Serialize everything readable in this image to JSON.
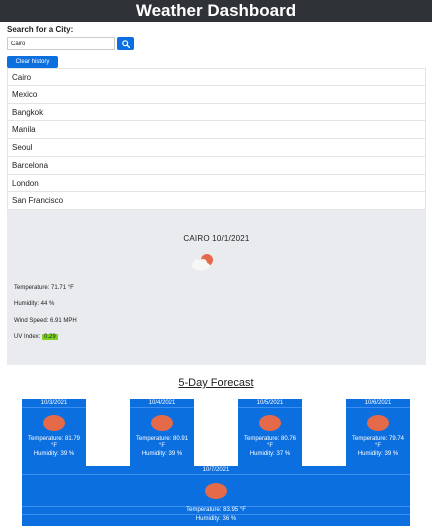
{
  "header": {
    "title": "Weather Dashboard"
  },
  "search": {
    "label": "Search for a City:",
    "value": "Cairo"
  },
  "clear_history_label": "Clear history",
  "history": [
    "Cairo",
    "Mexico",
    "Bangkok",
    "Manila",
    "Seoul",
    "Barcelona",
    "London",
    "San Francisco"
  ],
  "current": {
    "title": "CAIRO 10/1/2021",
    "icon": "partly-cloudy-icon",
    "temperature": "Temperature: 71.71 °F",
    "humidity": "Humidity: 44 %",
    "wind": "Wind Speed: 6.91 MPH",
    "uv_label": "UV Index:",
    "uv_value": "0.29"
  },
  "forecast": {
    "title": "5-Day Forecast",
    "days": [
      {
        "date": "10/3/2021",
        "temperature": "Temperature: 81.79",
        "unit": "°F",
        "humidity": "Humidity: 39 %"
      },
      {
        "date": "10/4/2021",
        "temperature": "Temperature: 80.91",
        "unit": "°F",
        "humidity": "Humidity: 39 %"
      },
      {
        "date": "10/5/2021",
        "temperature": "Temperature: 80.76",
        "unit": "°F",
        "humidity": "Humidity: 37 %"
      },
      {
        "date": "10/6/2021",
        "temperature": "Temperature: 79.74",
        "unit": "°F",
        "humidity": "Humidity: 39 %"
      },
      {
        "date": "10/7/2021",
        "temperature": "Temperature: 83.95 °F",
        "humidity": "Humidity: 36 %"
      }
    ]
  },
  "colors": {
    "header_bg": "#2f3338",
    "primary": "#0b6fe0",
    "uv_low": "#7ed321",
    "sun": "#e46a4a",
    "panel_bg": "#e9ebee"
  }
}
